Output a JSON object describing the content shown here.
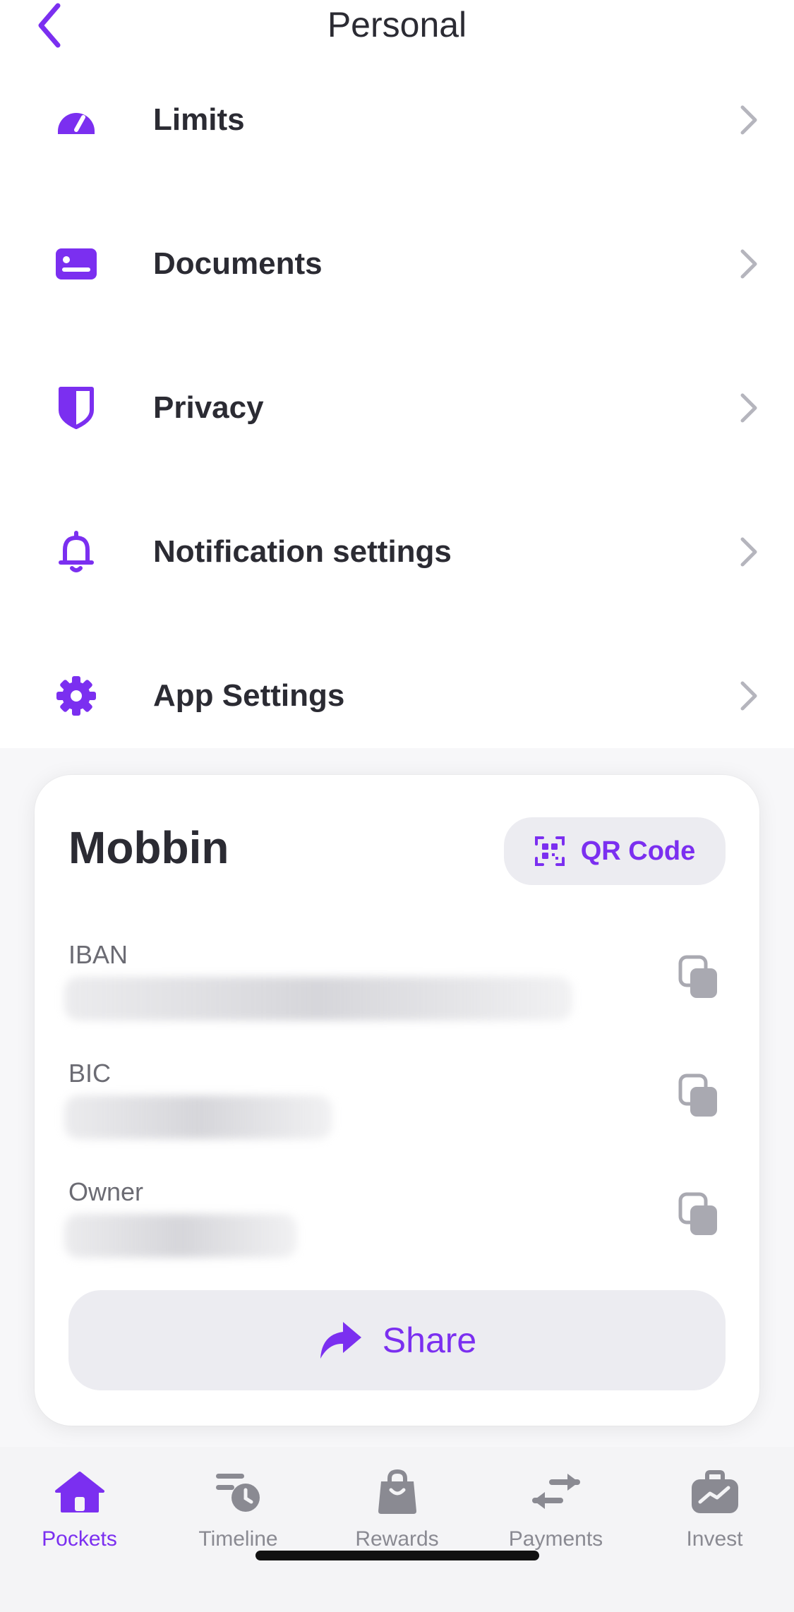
{
  "header": {
    "title": "Personal",
    "back_icon": "chevron-left-icon"
  },
  "menu": {
    "items": [
      {
        "label": "Limits",
        "icon": "gauge-icon"
      },
      {
        "label": "Documents",
        "icon": "id-card-icon"
      },
      {
        "label": "Privacy",
        "icon": "shield-icon"
      },
      {
        "label": "Notification settings",
        "icon": "bell-icon"
      },
      {
        "label": "App Settings",
        "icon": "gear-icon"
      }
    ],
    "chevron_icon": "chevron-right-icon"
  },
  "account": {
    "name": "Mobbin",
    "qr_button_label": "QR Code",
    "fields": [
      {
        "label": "IBAN",
        "value_hidden": true
      },
      {
        "label": "BIC",
        "value_hidden": true
      },
      {
        "label": "Owner",
        "value_hidden": true
      }
    ],
    "share_label": "Share"
  },
  "tabbar": {
    "tabs": [
      {
        "label": "Pockets",
        "icon": "home-icon",
        "active": true
      },
      {
        "label": "Timeline",
        "icon": "timeline-icon",
        "active": false
      },
      {
        "label": "Rewards",
        "icon": "shopping-bag-icon",
        "active": false
      },
      {
        "label": "Payments",
        "icon": "transfer-arrows-icon",
        "active": false
      },
      {
        "label": "Invest",
        "icon": "briefcase-chart-icon",
        "active": false
      }
    ]
  },
  "colors": {
    "accent": "#7b2ff0",
    "text": "#2b2b33",
    "muted": "#8a8a92",
    "button_bg": "#ececf1",
    "chevron": "#b5b5bd"
  }
}
